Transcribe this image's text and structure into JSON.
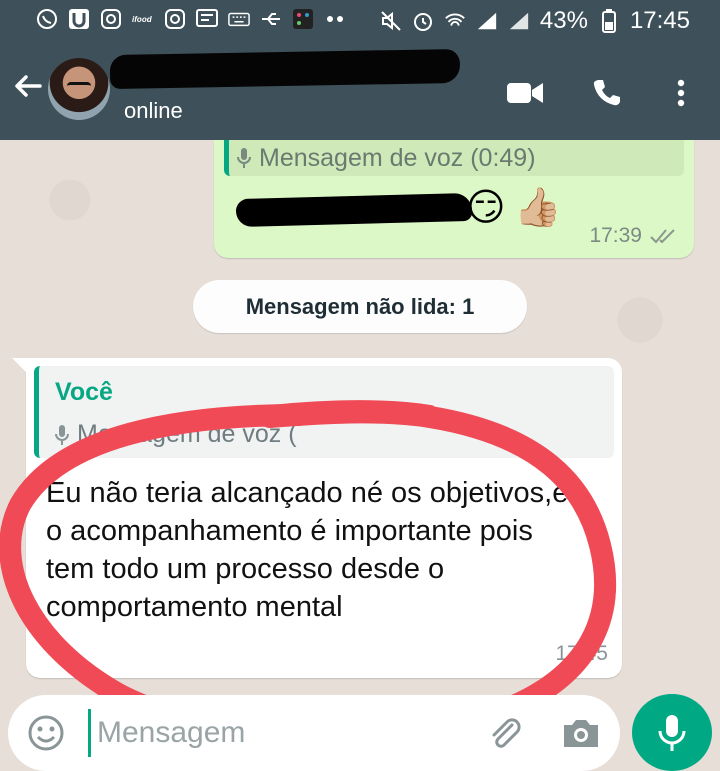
{
  "status_bar": {
    "battery": "43%",
    "time": "17:45",
    "icons": [
      "whatsapp-icon",
      "u-app-icon",
      "instagram-icon",
      "ifood-icon",
      "instagram-icon",
      "translate-icon",
      "keyboard-icon",
      "usb-icon",
      "app-grid-icon",
      "more-dots-icon",
      "mute-icon",
      "alarm-icon",
      "wifi-icon",
      "signal-icon",
      "signal-icon",
      "battery-icon"
    ]
  },
  "header": {
    "status": "online",
    "icons": [
      "back-arrow-icon",
      "video-call-icon",
      "phone-icon",
      "overflow-menu-icon"
    ]
  },
  "messages": {
    "outgoing": {
      "quote_text": "Mensagem de voz (0:49)",
      "emoji_1": "😏",
      "emoji_2": "👍🏼",
      "time": "17:39"
    },
    "unread_label": "Mensagem não lida: 1",
    "incoming": {
      "quote_sender": "Você",
      "quote_text": "Mensagem de voz (",
      "text": "Eu não teria alcançado né os objetivos,e o acompanhamento é importante pois tem todo um processo desde o comportamento mental",
      "time": "17:45"
    }
  },
  "composer": {
    "placeholder": "Mensagem"
  },
  "colors": {
    "header_bg": "#3e5059",
    "accent": "#00a884",
    "outgoing_bubble": "#dcf8c6",
    "annotation_red": "#ef4a55"
  }
}
